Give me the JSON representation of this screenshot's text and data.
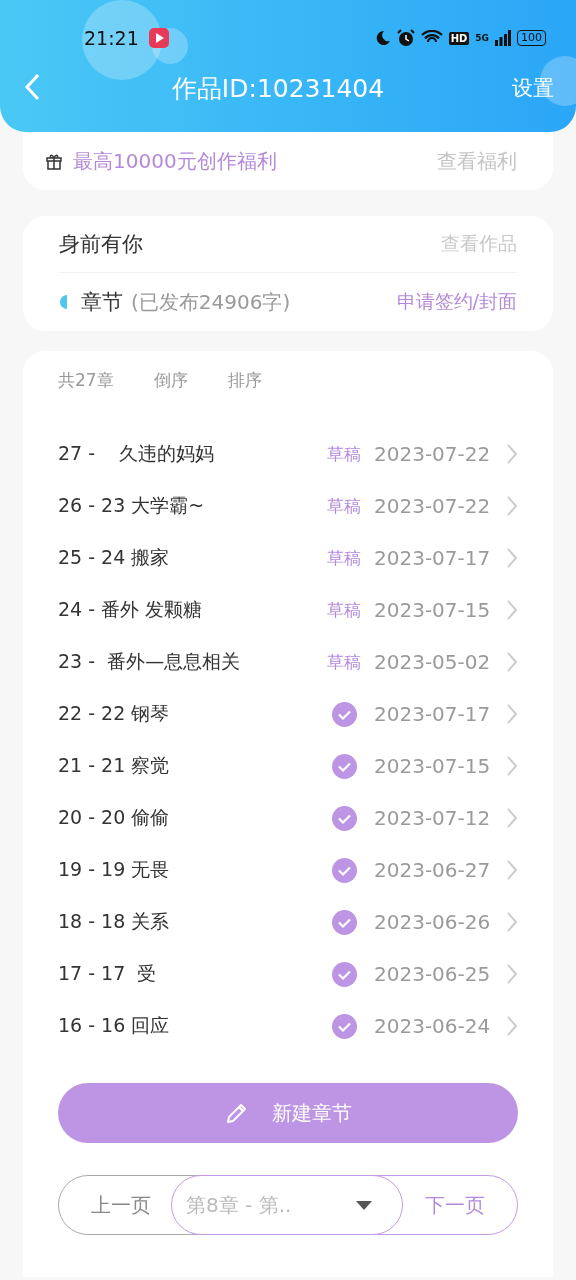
{
  "status_bar": {
    "time": "21:21",
    "hd": "HD",
    "network": "5G",
    "battery": "100"
  },
  "header": {
    "title": "作品ID:10231404",
    "action": "设置"
  },
  "welfare": {
    "text": "最高10000元创作福利",
    "link": "查看福利"
  },
  "work": {
    "title": "身前有你",
    "link": "查看作品",
    "section": "章节",
    "published": "(已发布24906字)",
    "action": "申请签约/封面"
  },
  "chapters": {
    "count": "共27章",
    "controls": [
      "倒序",
      "排序"
    ],
    "rows": [
      {
        "title": "27 -    久违的妈妈",
        "kind": "draft",
        "status": "草稿",
        "date": "2023-07-22"
      },
      {
        "title": "26 - 23 大学霸~",
        "kind": "draft",
        "status": "草稿",
        "date": "2023-07-22"
      },
      {
        "title": "25 - 24 搬家",
        "kind": "draft",
        "status": "草稿",
        "date": "2023-07-17"
      },
      {
        "title": "24 - 番外 发颗糖",
        "kind": "draft",
        "status": "草稿",
        "date": "2023-07-15"
      },
      {
        "title": "23 -  番外—息息相关",
        "kind": "draft",
        "status": "草稿",
        "date": "2023-05-02"
      },
      {
        "title": "22 - 22 钢琴",
        "kind": "published",
        "date": "2023-07-17"
      },
      {
        "title": "21 - 21 察觉",
        "kind": "published",
        "date": "2023-07-15"
      },
      {
        "title": "20 - 20 偷偷",
        "kind": "published",
        "date": "2023-07-12"
      },
      {
        "title": "19 - 19 无畏",
        "kind": "published",
        "date": "2023-06-27"
      },
      {
        "title": "18 - 18 关系",
        "kind": "published",
        "date": "2023-06-26"
      },
      {
        "title": "17 - 17  受",
        "kind": "published",
        "date": "2023-06-25"
      },
      {
        "title": "16 - 16 回应",
        "kind": "published",
        "date": "2023-06-24"
      }
    ]
  },
  "new_chapter_button": "新建章节",
  "pager": {
    "prev": "上一页",
    "select": "第8章 - 第..",
    "next": "下一页"
  }
}
